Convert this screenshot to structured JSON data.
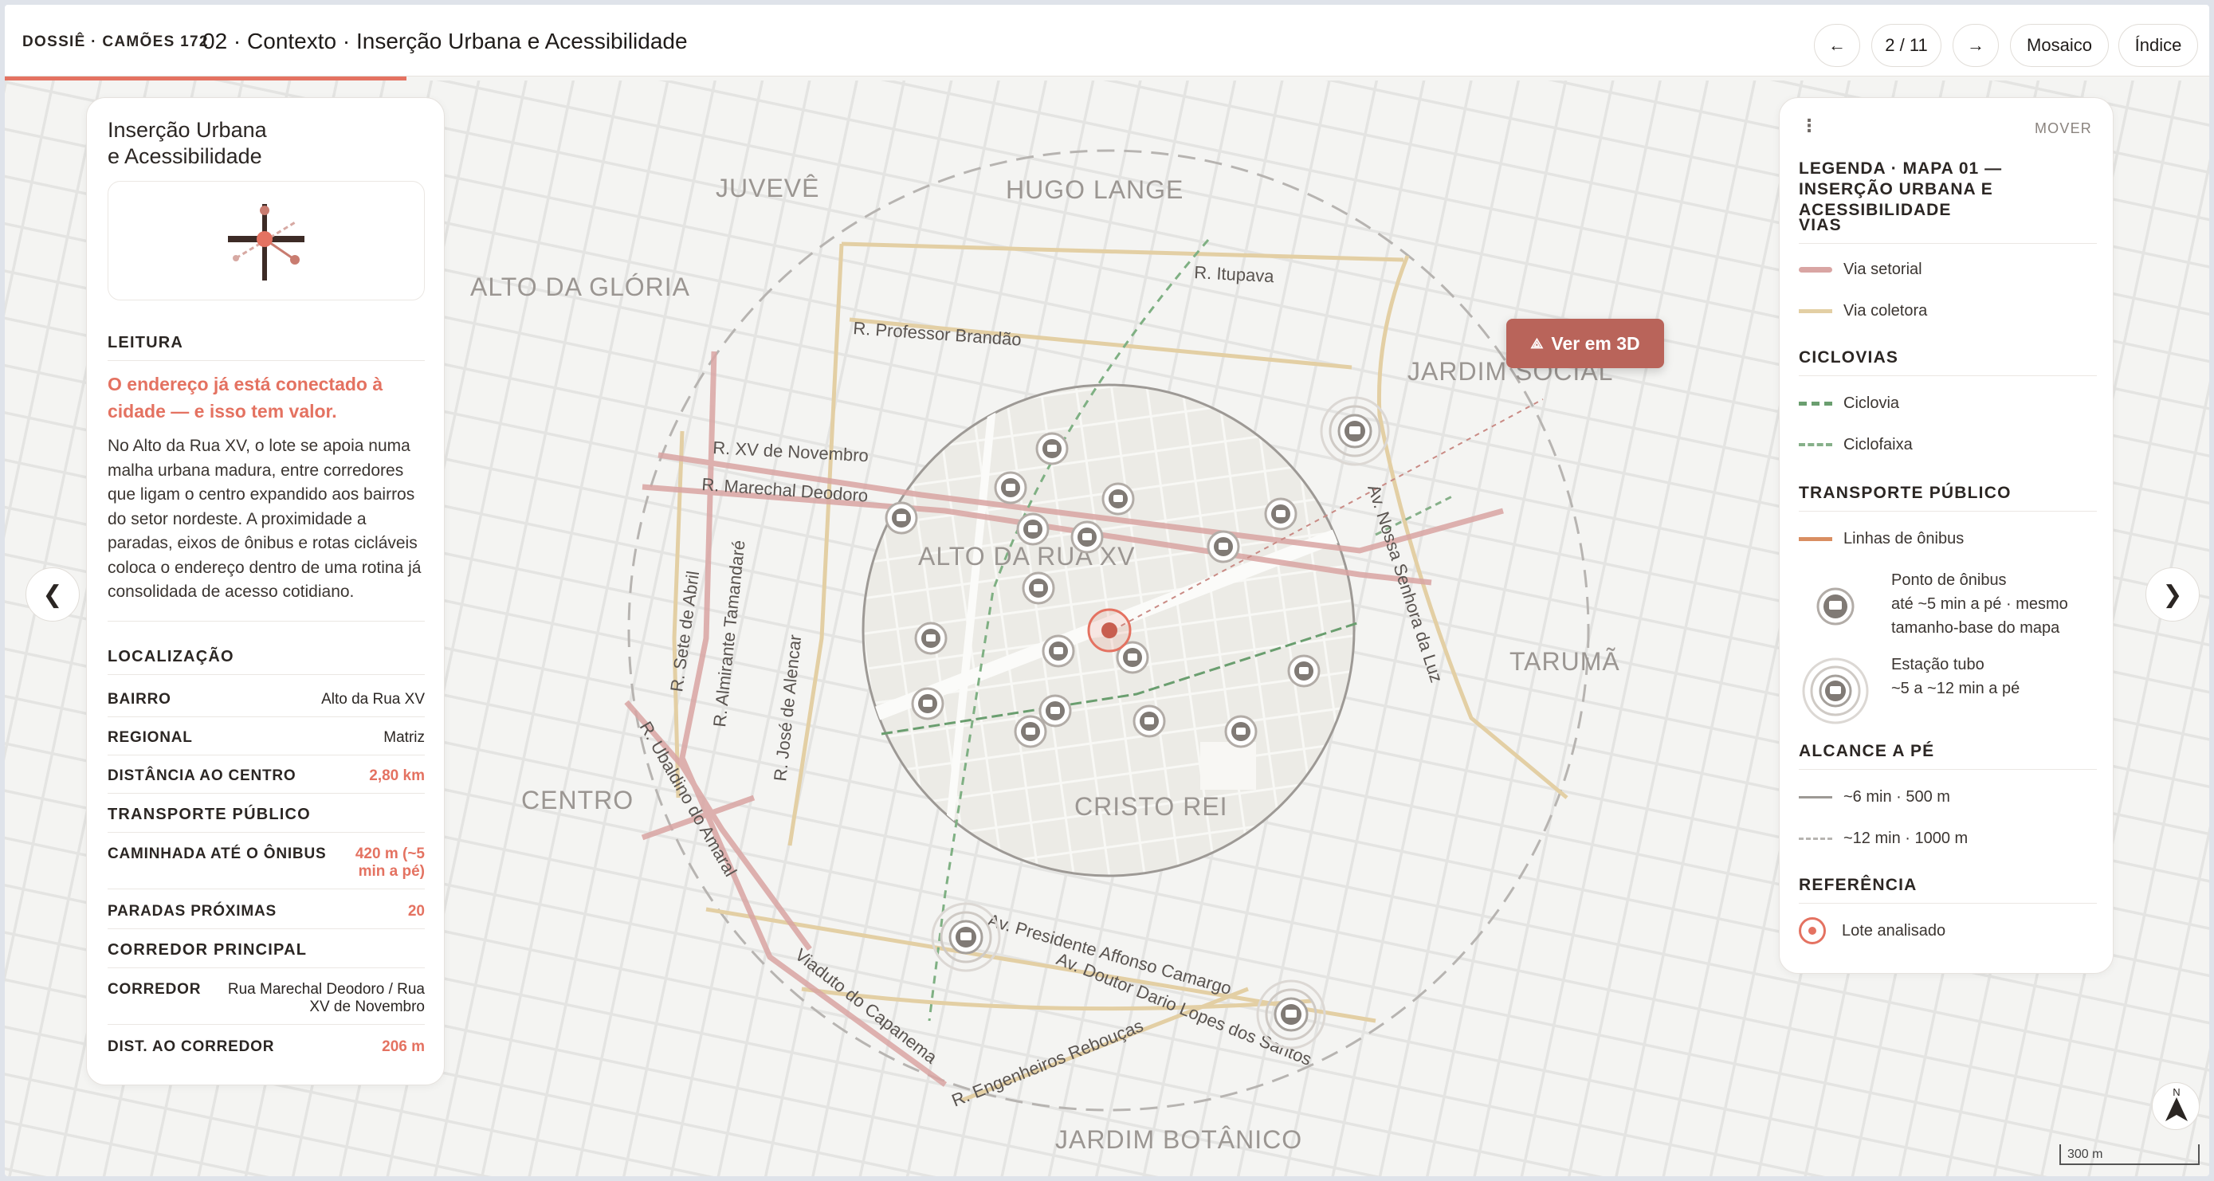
{
  "header": {
    "brand": "DOSSIÊ · CAMÕES 172",
    "title": "02 · Contexto · Inserção Urbana e Acessibilidade",
    "prev_label": "←",
    "page_indicator": "2 / 11",
    "next_label": "→",
    "mosaic_label": "Mosaico",
    "index_label": "Índice"
  },
  "panel": {
    "title_line1": "Inserção Urbana",
    "title_line2": "e Acessibilidade",
    "reading_heading": "LEITURA",
    "headline": "O endereço já está conectado à cidade — e isso tem valor.",
    "paragraph": "No Alto da Rua XV, o lote se apoia numa malha urbana madura, entre corredores que ligam o centro expandido aos bairros do setor nordeste. A proximidade a paradas, eixos de ônibus e rotas cicláveis coloca o endereço dentro de uma rotina já consolidada de acesso cotidiano.",
    "location_heading": "LOCALIZAÇÃO",
    "bairro_label": "BAIRRO",
    "bairro_value": "Alto da Rua XV",
    "regional_label": "REGIONAL",
    "regional_value": "Matriz",
    "distancia_label": "DISTÂNCIA AO CENTRO",
    "distancia_value": "2,80 km",
    "transport_heading": "TRANSPORTE PÚBLICO",
    "caminhada_label": "CAMINHADA ATÉ O ÔNIBUS",
    "caminhada_value": "420 m (~5 min a pé)",
    "paradas_label": "PARADAS PRÓXIMAS",
    "paradas_value": "20",
    "corridor_heading": "CORREDOR PRINCIPAL",
    "corredor_label": "CORREDOR",
    "corredor_value": "Rua Marechal Deodoro / Rua XV de Novembro",
    "dist_corredor_label": "DIST. AO CORREDOR",
    "dist_corredor_value": "206 m"
  },
  "legend": {
    "menu_icon": "⋮",
    "move_label": "MOVER",
    "title": "LEGENDA · MAPA 01 — INSERÇÃO URBANA E ACESSIBILIDADE",
    "vias_heading": "VIAS",
    "via_setorial": "Via setorial",
    "via_coletora": "Via coletora",
    "ciclovias_heading": "CICLOVIAS",
    "ciclovia": "Ciclovia",
    "ciclofaixa": "Ciclofaixa",
    "transporte_heading": "TRANSPORTE PÚBLICO",
    "linhas_onibus": "Linhas de ônibus",
    "ponto_line1": "Ponto de ônibus",
    "ponto_line2": "até ~5 min a pé · mesmo",
    "ponto_line3": "tamanho-base do mapa",
    "estacao_line1": "Estação tubo",
    "estacao_line2": "~5 a ~12 min a pé",
    "alcance_heading": "ALCANCE A PÉ",
    "alcance_6": "~6 min · 500 m",
    "alcance_12": "~12 min · 1000 m",
    "referencia_heading": "REFERÊNCIA",
    "lote": "Lote analisado",
    "colors": {
      "via_setorial": "#d9a5a3",
      "via_coletora": "#e3cfa4",
      "ciclovia": "#6a9e6f",
      "ciclofaixa": "#86b089",
      "onibus": "#d98e62",
      "accent": "#e47261"
    }
  },
  "map": {
    "ver3d_label": "Ver em 3D",
    "ver3d_icon": "cube-icon",
    "scale_label": "300 m",
    "compass_label": "N",
    "neighborhoods": {
      "juveve": "JUVEVÊ",
      "hugo_lange": "HUGO LANGE",
      "alto_gloria": "ALTO DA GLÓRIA",
      "jardim_social": "JARDIM SOCIAL",
      "alto_rua_xv": "ALTO DA RUA XV",
      "taruma": "TARUMÃ",
      "centro": "CENTRO",
      "cristo_rei": "CRISTO REI",
      "jardim_botanico": "JARDIM BOTÂNICO"
    },
    "streets": {
      "itupava": "R. Itupava",
      "professor_brandao": "R. Professor Brandão",
      "xv_novembro": "R. XV de Novembro",
      "marechal_deodoro": "R. Marechal Deodoro",
      "sete_abril": "R. Sete de Abril",
      "almirante_tamandare": "R. Almirante Tamandaré",
      "jose_alencar": "R. José de Alencar",
      "ubaldino_amaral": "R. Ubaldino do Amaral",
      "nossa_senhora_luz": "Av. Nossa Senhora da Luz",
      "affonso_camargo": "Av. Presidente Affonso Camargo",
      "dario_lopes": "Av. Doutor Dario Lopes dos Santos",
      "viaduto_capanema": "Viaduto do Capanema",
      "engenheiros_reboucas": "R. Engenheiros Rebouças"
    }
  },
  "nav": {
    "left_arrow": "❮",
    "right_arrow": "❯"
  }
}
